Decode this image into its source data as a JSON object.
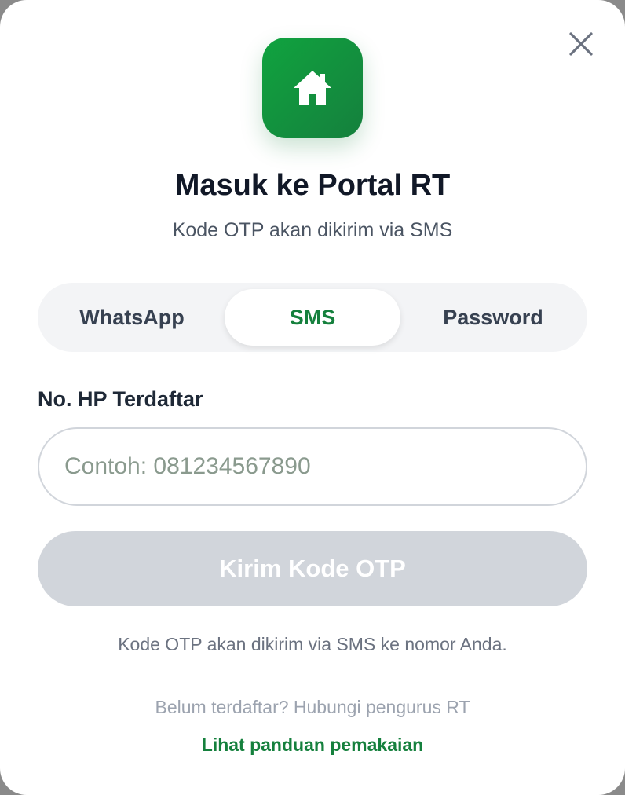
{
  "modal": {
    "title": "Masuk ke Portal RT",
    "subtitle": "Kode OTP akan dikirim via SMS",
    "logo_icon": "home-icon",
    "close_icon": "close-icon"
  },
  "tabs": [
    {
      "label": "WhatsApp",
      "active": false
    },
    {
      "label": "SMS",
      "active": true
    },
    {
      "label": "Password",
      "active": false
    }
  ],
  "form": {
    "phone_label": "No. HP Terdaftar",
    "phone_value": "",
    "phone_placeholder": "Contoh: 081234567890",
    "submit_label": "Kirim Kode OTP",
    "hint": "Kode OTP akan dikirim via SMS ke nomor Anda."
  },
  "footer": {
    "register_note": "Belum terdaftar? Hubungi pengurus RT",
    "guide_link": "Lihat panduan pemakaian"
  },
  "colors": {
    "accent": "#15803d",
    "disabled_button": "#d1d5db",
    "tab_background": "#f3f4f6"
  }
}
